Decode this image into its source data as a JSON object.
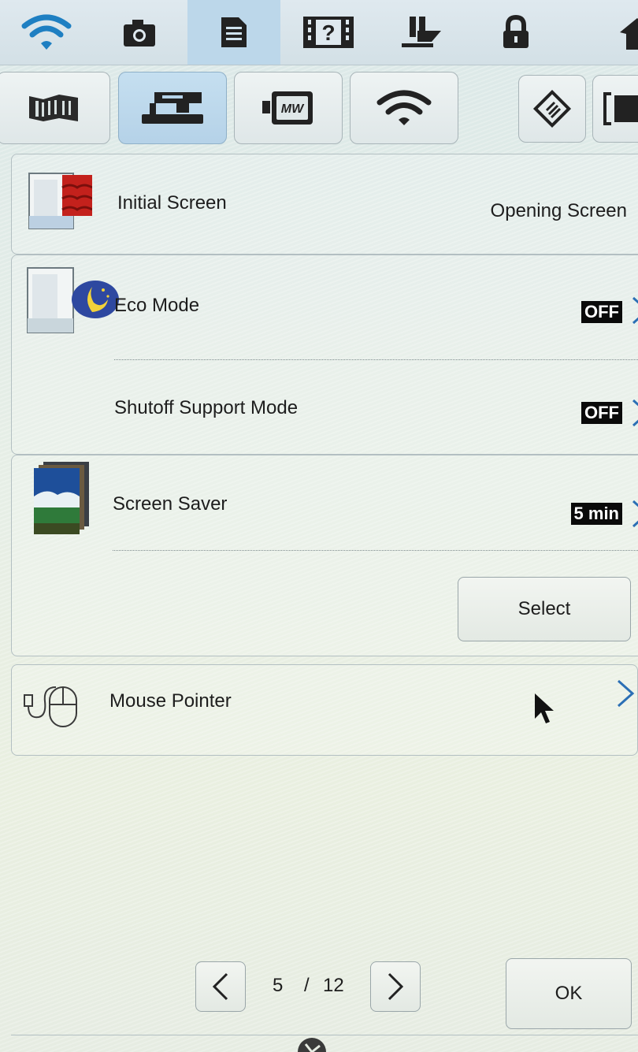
{
  "toolbar": {
    "icons": [
      "wifi-icon",
      "camera-icon",
      "document-icon",
      "help-icon",
      "presser-foot-icon",
      "lock-icon",
      "home-icon"
    ],
    "active_index": 2
  },
  "tabs": {
    "icons": [
      "machine-settings-icon",
      "sewing-machine-icon",
      "embroidery-frame-icon",
      "wifi-icon",
      "diamond-settings-icon",
      "frame-icon"
    ],
    "active_index": 1
  },
  "settings": {
    "initial_screen": {
      "label": "Initial Screen",
      "value": "Opening Screen"
    },
    "eco_mode": {
      "label": "Eco Mode",
      "value": "OFF"
    },
    "shutoff_support": {
      "label": "Shutoff Support Mode",
      "value": "OFF"
    },
    "screen_saver": {
      "label": "Screen Saver",
      "value": "5 min",
      "select_label": "Select"
    },
    "mouse_pointer": {
      "label": "Mouse Pointer"
    }
  },
  "pager": {
    "current": "5",
    "separator": "/",
    "total": "12"
  },
  "ok_label": "OK",
  "colors": {
    "accent_tab": "#b5d2e8",
    "badge_bg": "#0a0a0a",
    "chevron": "#2b6fb5",
    "wifi_icon": "#1e7fc2"
  }
}
